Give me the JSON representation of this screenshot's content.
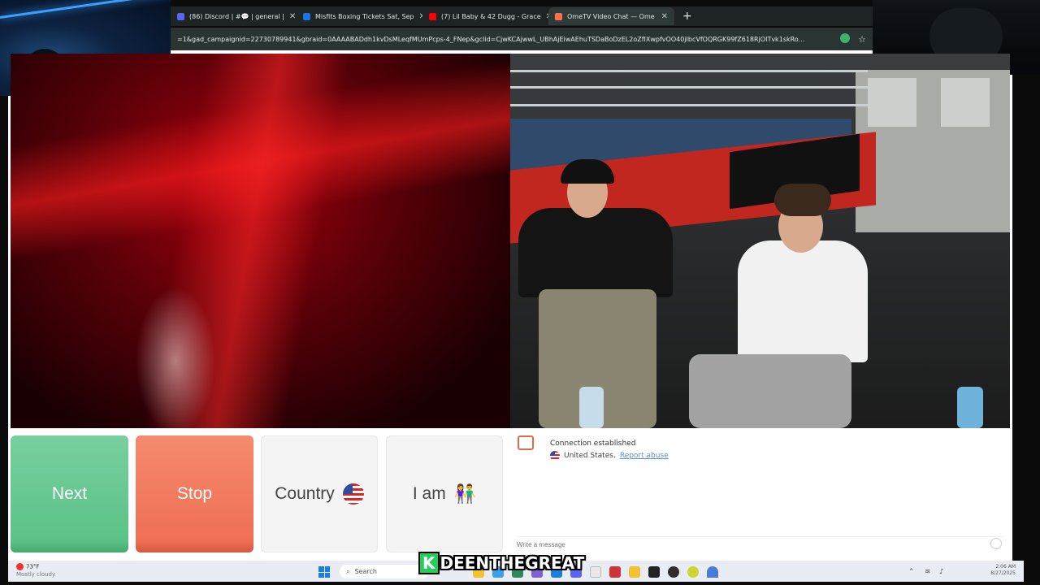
{
  "browser": {
    "tabs": [
      {
        "label": "(86) Discord | #💬 | general |",
        "active": false,
        "favicon_color": "#5865F2"
      },
      {
        "label": "Misfits Boxing Tickets Sat, Sep",
        "active": false,
        "favicon_color": "#1a73e8"
      },
      {
        "label": "(7) Lil Baby & 42 Dugg - Grace",
        "active": false,
        "favicon_color": "#ff0000"
      },
      {
        "label": "OmeTV Video Chat — Ome",
        "active": true,
        "favicon_color": "#ff6f4f"
      }
    ],
    "new_tab_label": "+",
    "url": "=1&gad_campaignid=22730789941&gbraid=0AAAABADdh1kvDsMLeqfMUmPcps-4_FNep&gclid=CjwKCAjwwL_UBhAjEiwAEhuTSDaBoDzEL2oZfIXwpfvOO40jIbcVfOQRGK99fZ618RjOITvk1skRo...",
    "star_icon": "star-icon"
  },
  "buttons": {
    "next_label": "Next",
    "stop_label": "Stop",
    "country_label": "Country",
    "iam_label": "I am",
    "couple_emoji": "👫"
  },
  "chat": {
    "status": "Connection established",
    "country": "United States.",
    "report_label": "Report abuse",
    "input_placeholder": "Write a message"
  },
  "watermark": {
    "k": "K",
    "rest": "DEENTHEGREAT"
  },
  "taskbar": {
    "weather_temp": "73°F",
    "weather_desc": "Mostly cloudy",
    "search_label": "Search",
    "time": "2:06 AM",
    "date": "8/27/2025"
  },
  "colors": {
    "next_green": "#5bc287",
    "stop_orange": "#ef6f53",
    "link_blue": "#5b8fd6"
  }
}
